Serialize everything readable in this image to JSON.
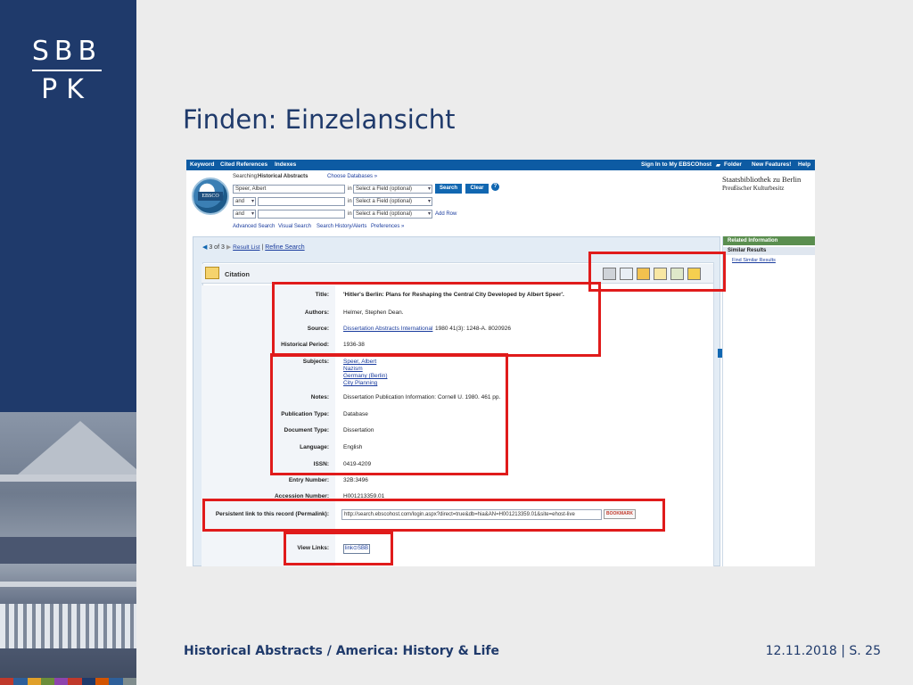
{
  "logo": {
    "top": "SBB",
    "bottom": "PK"
  },
  "slide": {
    "title": "Finden: Einzelansicht"
  },
  "footer": {
    "left": "Historical Abstracts / America: History & Life",
    "right": "12.11.2018 | S. 25"
  },
  "ebsco": {
    "topnav": {
      "keyword": "Keyword",
      "cited": "Cited References",
      "indexes": "Indexes",
      "signin": "Sign In to My EBSCOhost",
      "folder": "Folder",
      "newfeatures": "New Features!",
      "help": "Help"
    },
    "logo_text": "EBSCO",
    "searching_label": "Searching:",
    "database": "Historical Abstracts",
    "choose_db": "Choose Databases »",
    "query": {
      "row1_value": "Speer, Albert",
      "row2_op": "and",
      "row3_op": "and",
      "in_label": "in",
      "field_select": "Select a Field (optional)",
      "search_btn": "Search",
      "clear_btn": "Clear",
      "add_row": "Add Row"
    },
    "links": {
      "advanced": "Advanced Search",
      "visual": "Visual Search",
      "history": "Search History/Alerts",
      "prefs": "Preferences »"
    },
    "library": {
      "name": "Staatsbibliothek zu Berlin",
      "sub": "Preußischer Kulturbesitz"
    },
    "pager": {
      "position": "3 of 3",
      "result_list": "Result List",
      "refine": "Refine Search"
    },
    "citation_label": "Citation",
    "record": {
      "title_label": "Title:",
      "title_value": "'Hitler's Berlin: Plans for Reshaping the Central City Developed by Albert Speer'.",
      "authors_label": "Authors:",
      "authors_value": "Helmer, Stephen Dean.",
      "source_label": "Source:",
      "source_link": "Dissertation Abstracts International",
      "source_rest": "1980 41(3): 1248-A. 8020926",
      "period_label": "Historical Period:",
      "period_value": "1936-38",
      "subjects_label": "Subjects:",
      "subjects": [
        "Speer, Albert",
        "Nazism",
        "Germany (Berlin)",
        "City Planning"
      ],
      "notes_label": "Notes:",
      "notes_value": "Dissertation Publication Information: Cornell U. 1980. 461 pp.",
      "pubtype_label": "Publication Type:",
      "pubtype_value": "Database",
      "doctype_label": "Document Type:",
      "doctype_value": "Dissertation",
      "language_label": "Language:",
      "language_value": "English",
      "issn_label": "ISSN:",
      "issn_value": "0419-4209",
      "entry_label": "Entry Number:",
      "entry_value": "32B:3496",
      "accession_label": "Accession Number:",
      "accession_value": "H001213359.01",
      "permalink_label": "Persistent link to this record (Permalink):",
      "permalink_value": "http://search.ebscohost.com/login.aspx?direct=true&db=hia&AN=H001213359.01&site=ehost-live",
      "bookmark": "BOOKMARK",
      "viewlinks_label": "View Links:",
      "linksbb": "link⊙SBB"
    },
    "side": {
      "header": "Related Information",
      "sub": "Similar Results",
      "link": "Find Similar Results"
    }
  },
  "colors": {
    "brand_navy": "#1f3a6b",
    "ebsco_blue": "#0d5ba3",
    "annotation_red": "#e01b1b"
  }
}
